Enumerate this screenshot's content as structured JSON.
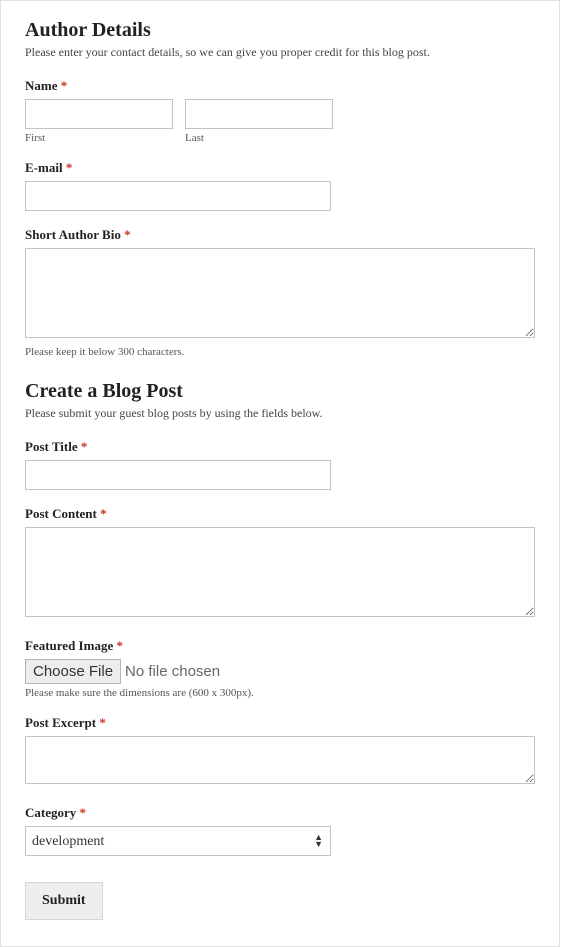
{
  "author": {
    "heading": "Author Details",
    "description": "Please enter your contact details, so we can give you proper credit for this blog post.",
    "name": {
      "label": "Name",
      "first_value": "",
      "first_sublabel": "First",
      "last_value": "",
      "last_sublabel": "Last"
    },
    "email": {
      "label": "E-mail",
      "value": ""
    },
    "bio": {
      "label": "Short Author Bio",
      "value": "",
      "help": "Please keep it below 300 characters."
    }
  },
  "post": {
    "heading": "Create a Blog Post",
    "description": "Please submit your guest blog posts by using the fields below.",
    "title": {
      "label": "Post Title",
      "value": ""
    },
    "content": {
      "label": "Post Content",
      "value": ""
    },
    "featured": {
      "label": "Featured Image",
      "button": "Choose File",
      "status": "No file chosen",
      "help": "Please make sure the dimensions are (600 x 300px)."
    },
    "excerpt": {
      "label": "Post Excerpt",
      "value": ""
    },
    "category": {
      "label": "Category",
      "selected": "development"
    }
  },
  "submit_label": "Submit",
  "required_marker": "*"
}
